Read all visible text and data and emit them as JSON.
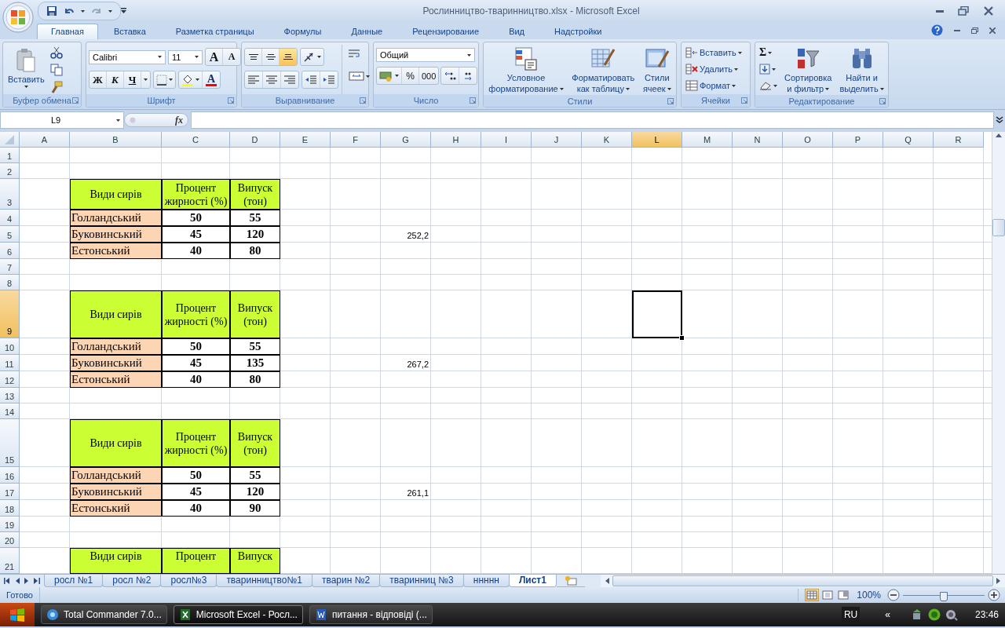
{
  "window": {
    "title": "Рослинництво-тваринництво.xlsx - Microsoft Excel"
  },
  "ribbon_tabs": [
    {
      "label": "Главная",
      "selected": true
    },
    {
      "label": "Вставка",
      "selected": false
    },
    {
      "label": "Разметка страницы",
      "selected": false
    },
    {
      "label": "Формулы",
      "selected": false
    },
    {
      "label": "Данные",
      "selected": false
    },
    {
      "label": "Рецензирование",
      "selected": false
    },
    {
      "label": "Вид",
      "selected": false
    },
    {
      "label": "Надстройки",
      "selected": false
    }
  ],
  "clipboard": {
    "title": "Буфер обмена",
    "paste": "Вставить"
  },
  "font": {
    "title": "Шрифт",
    "font_name": "Calibri",
    "font_size": "11",
    "grow": "A",
    "shrink": "A",
    "bold": "Ж",
    "italic": "К",
    "underline": "Ч",
    "font_color": "A"
  },
  "alignment": {
    "title": "Выравнивание",
    "vertical_align": [
      {
        "kind": "top",
        "selected": false
      },
      {
        "kind": "middle",
        "selected": false
      },
      {
        "kind": "bottom",
        "selected": true
      }
    ]
  },
  "number": {
    "title": "Число",
    "format": "Общий",
    "percent": "%",
    "thousands": "000"
  },
  "styles": {
    "title": "Стили",
    "buttons": [
      {
        "kind": "conditional",
        "lines": [
          "Условное",
          "форматирование"
        ]
      },
      {
        "kind": "table",
        "lines": [
          "Форматировать",
          "как таблицу"
        ]
      },
      {
        "kind": "cellstyle",
        "lines": [
          "Стили",
          "ячеек"
        ]
      }
    ]
  },
  "cells": {
    "title": "Ячейки",
    "buttons": [
      {
        "kind": "insert",
        "label": "Вставить"
      },
      {
        "kind": "delete",
        "label": "Удалить"
      },
      {
        "kind": "format",
        "label": "Формат"
      }
    ]
  },
  "editing": {
    "title": "Редактирование",
    "sum": "Σ",
    "buttons": [
      {
        "kind": "sort",
        "lines": [
          "Сортировка",
          "и фильтр"
        ]
      },
      {
        "kind": "find",
        "lines": [
          "Найти и",
          "выделить"
        ]
      }
    ]
  },
  "formula_bar": {
    "name_box": "L9",
    "function_label": "fx"
  },
  "sheet": {
    "columns": [
      {
        "label": "A",
        "selected": false
      },
      {
        "label": "B",
        "selected": false
      },
      {
        "label": "C",
        "selected": false
      },
      {
        "label": "D",
        "selected": false
      },
      {
        "label": "E",
        "selected": false
      },
      {
        "label": "F",
        "selected": false
      },
      {
        "label": "G",
        "selected": false
      },
      {
        "label": "H",
        "selected": false
      },
      {
        "label": "I",
        "selected": false
      },
      {
        "label": "J",
        "selected": false
      },
      {
        "label": "K",
        "selected": false
      },
      {
        "label": "L",
        "selected": true
      },
      {
        "label": "M",
        "selected": false
      },
      {
        "label": "N",
        "selected": false
      },
      {
        "label": "O",
        "selected": false
      },
      {
        "label": "P",
        "selected": false
      },
      {
        "label": "Q",
        "selected": false
      },
      {
        "label": "R",
        "selected": false
      }
    ],
    "rows": [
      {
        "number": "1",
        "selected": false
      },
      {
        "number": "2",
        "selected": false
      },
      {
        "number": "3",
        "selected": false,
        "cells": {
          "b": {
            "kind": "header",
            "text": "Види сирів"
          },
          "c": {
            "kind": "header",
            "text": "Процент жирності (%)"
          },
          "d": {
            "kind": "header",
            "text": "Випуск (тон)"
          }
        }
      },
      {
        "number": "4",
        "selected": false,
        "cells": {
          "b": {
            "kind": "name",
            "text": "Голландський"
          },
          "c": {
            "kind": "value",
            "text": "50"
          },
          "d": {
            "kind": "value",
            "text": "55"
          }
        }
      },
      {
        "number": "5",
        "selected": false,
        "cells": {
          "b": {
            "kind": "name",
            "text": "Буковинський"
          },
          "c": {
            "kind": "value",
            "text": "45"
          },
          "d": {
            "kind": "value",
            "text": "120"
          },
          "g": {
            "kind": "result",
            "text": "252,2"
          }
        }
      },
      {
        "number": "6",
        "selected": false,
        "cells": {
          "b": {
            "kind": "name",
            "text": "Естонський"
          },
          "c": {
            "kind": "value",
            "text": "40"
          },
          "d": {
            "kind": "value",
            "text": "80"
          }
        }
      },
      {
        "number": "7",
        "selected": false
      },
      {
        "number": "8",
        "selected": false
      },
      {
        "number": "9",
        "selected": true,
        "cells": {
          "b": {
            "kind": "header",
            "text": "Види сирів"
          },
          "c": {
            "kind": "header",
            "text": "Процент жирності (%)"
          },
          "d": {
            "kind": "header",
            "text": "Випуск (тон)"
          }
        }
      },
      {
        "number": "10",
        "selected": false,
        "cells": {
          "b": {
            "kind": "name",
            "text": "Голландський"
          },
          "c": {
            "kind": "value",
            "text": "50"
          },
          "d": {
            "kind": "value",
            "text": "55"
          }
        }
      },
      {
        "number": "11",
        "selected": false,
        "cells": {
          "b": {
            "kind": "name",
            "text": "Буковинський"
          },
          "c": {
            "kind": "value",
            "text": "45"
          },
          "d": {
            "kind": "value",
            "text": "135"
          },
          "g": {
            "kind": "result",
            "text": "267,2"
          }
        }
      },
      {
        "number": "12",
        "selected": false,
        "cells": {
          "b": {
            "kind": "name",
            "text": "Естонський"
          },
          "c": {
            "kind": "value",
            "text": "40"
          },
          "d": {
            "kind": "value",
            "text": "80"
          }
        }
      },
      {
        "number": "13",
        "selected": false
      },
      {
        "number": "14",
        "selected": false
      },
      {
        "number": "15",
        "selected": false,
        "cells": {
          "b": {
            "kind": "header",
            "text": "Види сирів"
          },
          "c": {
            "kind": "header",
            "text": "Процент жирності (%)"
          },
          "d": {
            "kind": "header",
            "text": "Випуск (тон)"
          }
        }
      },
      {
        "number": "16",
        "selected": false,
        "cells": {
          "b": {
            "kind": "name",
            "text": "Голландський"
          },
          "c": {
            "kind": "value",
            "text": "50"
          },
          "d": {
            "kind": "value",
            "text": "55"
          }
        }
      },
      {
        "number": "17",
        "selected": false,
        "cells": {
          "b": {
            "kind": "name",
            "text": "Буковинський"
          },
          "c": {
            "kind": "value",
            "text": "45"
          },
          "d": {
            "kind": "value",
            "text": "120"
          },
          "g": {
            "kind": "result",
            "text": "261,1"
          }
        }
      },
      {
        "number": "18",
        "selected": false,
        "cells": {
          "b": {
            "kind": "name",
            "text": "Естонський"
          },
          "c": {
            "kind": "value",
            "text": "40"
          },
          "d": {
            "kind": "value",
            "text": "90"
          }
        }
      },
      {
        "number": "19",
        "selected": false
      },
      {
        "number": "20",
        "selected": false
      },
      {
        "number": "21",
        "selected": false,
        "cells": {
          "b": {
            "kind": "header",
            "text": "Види сирів"
          },
          "c": {
            "kind": "header",
            "text": "Процент"
          },
          "d": {
            "kind": "header",
            "text": "Випуск"
          }
        }
      }
    ]
  },
  "sheet_tabs": [
    {
      "label": "росл №1",
      "selected": false
    },
    {
      "label": "росл №2",
      "selected": false
    },
    {
      "label": "росл№3",
      "selected": false
    },
    {
      "label": "тваринництво№1",
      "selected": false
    },
    {
      "label": "тварин №2",
      "selected": false
    },
    {
      "label": "тваринниц №3",
      "selected": false
    },
    {
      "label": "ннннн",
      "selected": false
    },
    {
      "label": "Лист1",
      "selected": true
    }
  ],
  "status_bar": {
    "status": "Готово",
    "views": [
      {
        "kind": "normal",
        "selected": true
      },
      {
        "kind": "layout",
        "selected": false
      },
      {
        "kind": "pagebreak",
        "selected": false
      }
    ],
    "zoom": "100%",
    "zoom_level": {
      "level": 0.5
    }
  },
  "taskbar": {
    "tasks": [
      {
        "kind": "commander",
        "label": "Total Commander 7.0...",
        "selected": false
      },
      {
        "kind": "excel",
        "label": "Microsoft Excel - Росл...",
        "selected": true
      },
      {
        "kind": "word",
        "label": "питання - відповіді (...",
        "selected": false
      }
    ],
    "language": "RU",
    "chevron": "«",
    "clock": "23:46"
  }
}
